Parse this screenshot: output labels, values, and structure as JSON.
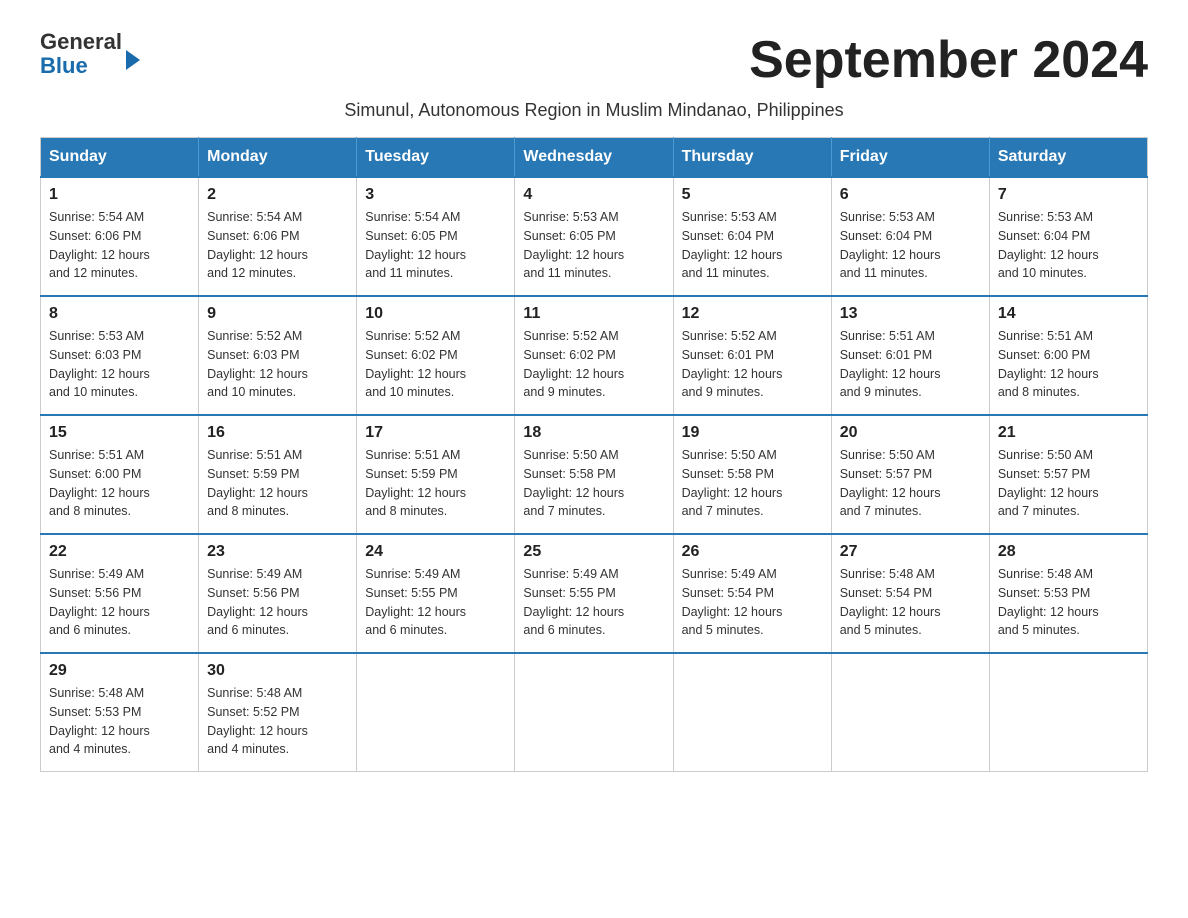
{
  "header": {
    "logo": {
      "general": "General",
      "blue": "Blue"
    },
    "title": "September 2024",
    "subtitle": "Simunul, Autonomous Region in Muslim Mindanao, Philippines"
  },
  "weekdays": [
    "Sunday",
    "Monday",
    "Tuesday",
    "Wednesday",
    "Thursday",
    "Friday",
    "Saturday"
  ],
  "weeks": [
    [
      {
        "day": "1",
        "sunrise": "5:54 AM",
        "sunset": "6:06 PM",
        "daylight": "12 hours and 12 minutes."
      },
      {
        "day": "2",
        "sunrise": "5:54 AM",
        "sunset": "6:06 PM",
        "daylight": "12 hours and 12 minutes."
      },
      {
        "day": "3",
        "sunrise": "5:54 AM",
        "sunset": "6:05 PM",
        "daylight": "12 hours and 11 minutes."
      },
      {
        "day": "4",
        "sunrise": "5:53 AM",
        "sunset": "6:05 PM",
        "daylight": "12 hours and 11 minutes."
      },
      {
        "day": "5",
        "sunrise": "5:53 AM",
        "sunset": "6:04 PM",
        "daylight": "12 hours and 11 minutes."
      },
      {
        "day": "6",
        "sunrise": "5:53 AM",
        "sunset": "6:04 PM",
        "daylight": "12 hours and 11 minutes."
      },
      {
        "day": "7",
        "sunrise": "5:53 AM",
        "sunset": "6:04 PM",
        "daylight": "12 hours and 10 minutes."
      }
    ],
    [
      {
        "day": "8",
        "sunrise": "5:53 AM",
        "sunset": "6:03 PM",
        "daylight": "12 hours and 10 minutes."
      },
      {
        "day": "9",
        "sunrise": "5:52 AM",
        "sunset": "6:03 PM",
        "daylight": "12 hours and 10 minutes."
      },
      {
        "day": "10",
        "sunrise": "5:52 AM",
        "sunset": "6:02 PM",
        "daylight": "12 hours and 10 minutes."
      },
      {
        "day": "11",
        "sunrise": "5:52 AM",
        "sunset": "6:02 PM",
        "daylight": "12 hours and 9 minutes."
      },
      {
        "day": "12",
        "sunrise": "5:52 AM",
        "sunset": "6:01 PM",
        "daylight": "12 hours and 9 minutes."
      },
      {
        "day": "13",
        "sunrise": "5:51 AM",
        "sunset": "6:01 PM",
        "daylight": "12 hours and 9 minutes."
      },
      {
        "day": "14",
        "sunrise": "5:51 AM",
        "sunset": "6:00 PM",
        "daylight": "12 hours and 8 minutes."
      }
    ],
    [
      {
        "day": "15",
        "sunrise": "5:51 AM",
        "sunset": "6:00 PM",
        "daylight": "12 hours and 8 minutes."
      },
      {
        "day": "16",
        "sunrise": "5:51 AM",
        "sunset": "5:59 PM",
        "daylight": "12 hours and 8 minutes."
      },
      {
        "day": "17",
        "sunrise": "5:51 AM",
        "sunset": "5:59 PM",
        "daylight": "12 hours and 8 minutes."
      },
      {
        "day": "18",
        "sunrise": "5:50 AM",
        "sunset": "5:58 PM",
        "daylight": "12 hours and 7 minutes."
      },
      {
        "day": "19",
        "sunrise": "5:50 AM",
        "sunset": "5:58 PM",
        "daylight": "12 hours and 7 minutes."
      },
      {
        "day": "20",
        "sunrise": "5:50 AM",
        "sunset": "5:57 PM",
        "daylight": "12 hours and 7 minutes."
      },
      {
        "day": "21",
        "sunrise": "5:50 AM",
        "sunset": "5:57 PM",
        "daylight": "12 hours and 7 minutes."
      }
    ],
    [
      {
        "day": "22",
        "sunrise": "5:49 AM",
        "sunset": "5:56 PM",
        "daylight": "12 hours and 6 minutes."
      },
      {
        "day": "23",
        "sunrise": "5:49 AM",
        "sunset": "5:56 PM",
        "daylight": "12 hours and 6 minutes."
      },
      {
        "day": "24",
        "sunrise": "5:49 AM",
        "sunset": "5:55 PM",
        "daylight": "12 hours and 6 minutes."
      },
      {
        "day": "25",
        "sunrise": "5:49 AM",
        "sunset": "5:55 PM",
        "daylight": "12 hours and 6 minutes."
      },
      {
        "day": "26",
        "sunrise": "5:49 AM",
        "sunset": "5:54 PM",
        "daylight": "12 hours and 5 minutes."
      },
      {
        "day": "27",
        "sunrise": "5:48 AM",
        "sunset": "5:54 PM",
        "daylight": "12 hours and 5 minutes."
      },
      {
        "day": "28",
        "sunrise": "5:48 AM",
        "sunset": "5:53 PM",
        "daylight": "12 hours and 5 minutes."
      }
    ],
    [
      {
        "day": "29",
        "sunrise": "5:48 AM",
        "sunset": "5:53 PM",
        "daylight": "12 hours and 4 minutes."
      },
      {
        "day": "30",
        "sunrise": "5:48 AM",
        "sunset": "5:52 PM",
        "daylight": "12 hours and 4 minutes."
      },
      null,
      null,
      null,
      null,
      null
    ]
  ],
  "labels": {
    "sunrise": "Sunrise:",
    "sunset": "Sunset:",
    "daylight": "Daylight:"
  }
}
